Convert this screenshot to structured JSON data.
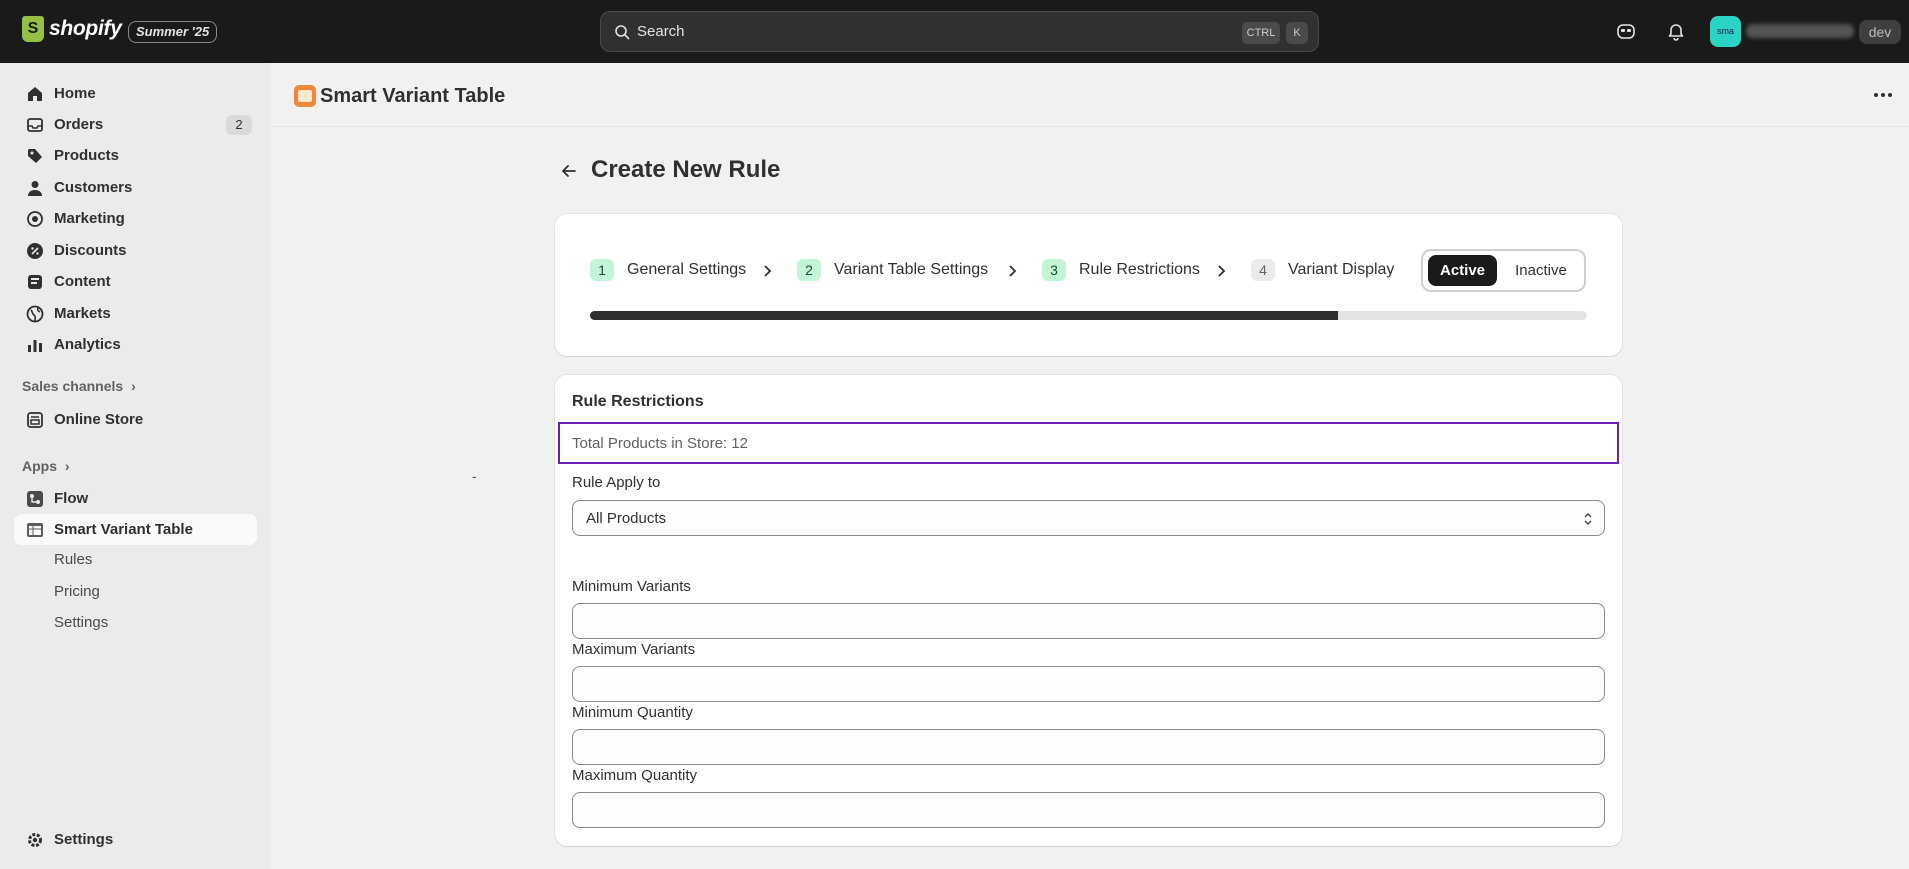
{
  "topbar": {
    "logo_mark": "S",
    "logo_text": "shopify",
    "edition_badge": "Summer '25",
    "search_placeholder": "Search",
    "kbd_ctrl": "CTRL",
    "kbd_k": "K",
    "avatar_initials": "sma",
    "env_badge": "dev"
  },
  "sidebar": {
    "items": [
      {
        "label": "Home",
        "icon": "home-icon"
      },
      {
        "label": "Orders",
        "icon": "orders-icon",
        "badge": "2"
      },
      {
        "label": "Products",
        "icon": "tag-icon"
      },
      {
        "label": "Customers",
        "icon": "person-icon"
      },
      {
        "label": "Marketing",
        "icon": "target-icon"
      },
      {
        "label": "Discounts",
        "icon": "discount-icon"
      },
      {
        "label": "Content",
        "icon": "content-icon"
      },
      {
        "label": "Markets",
        "icon": "globe-icon"
      },
      {
        "label": "Analytics",
        "icon": "bar-chart-icon"
      }
    ],
    "sales_channels_title": "Sales channels",
    "online_store": "Online Store",
    "apps_title": "Apps",
    "flow": "Flow",
    "smart_variant_table": "Smart Variant Table",
    "sub_items": [
      "Rules",
      "Pricing",
      "Settings"
    ],
    "settings": "Settings"
  },
  "header": {
    "app_title": "Smart Variant Table"
  },
  "page": {
    "title": "Create New Rule",
    "dash": "-"
  },
  "steps": [
    {
      "num": "1",
      "label": "General Settings",
      "done": true
    },
    {
      "num": "2",
      "label": "Variant Table Settings",
      "done": true
    },
    {
      "num": "3",
      "label": "Rule Restrictions",
      "done": true
    },
    {
      "num": "4",
      "label": "Variant Display",
      "done": false
    }
  ],
  "status_toggle": {
    "active": "Active",
    "inactive": "Inactive",
    "selected": "Active"
  },
  "progress_fraction": 0.75,
  "rules": {
    "title": "Rule Restrictions",
    "total_products": "Total Products in Store: 12",
    "apply_label": "Rule Apply to",
    "apply_value": "All Products",
    "min_variants_label": "Minimum Variants",
    "max_variants_label": "Maximum Variants",
    "min_quantity_label": "Minimum Quantity",
    "max_quantity_label": "Maximum Quantity"
  },
  "colors": {
    "topbar_bg": "#1a1a1a",
    "focus_outline": "#6a1fb0",
    "step_done_bg": "#c3f5d5",
    "progress_fill": "#303030"
  }
}
